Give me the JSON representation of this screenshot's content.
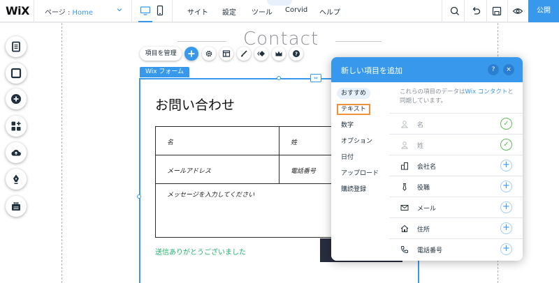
{
  "topbar": {
    "logo": "WiX",
    "page_label": "ページ : ",
    "page_value": "Home",
    "menu": [
      "サイト",
      "設定",
      "ツール",
      "Corvid",
      "ヘルプ"
    ],
    "publish_label": "公開"
  },
  "canvas": {
    "heading": "Contact"
  },
  "toolbar": {
    "manage_label": "項目を管理"
  },
  "form": {
    "tag_label": "Wix フォーム",
    "title": "お問い合わせ",
    "fields": {
      "first_name": "名",
      "last_name": "姓",
      "email": "メールアドレス",
      "phone": "電話番号",
      "message": "メッセージを入力してください"
    },
    "thanks": "送信ありがとうございました"
  },
  "panel": {
    "title": "新しい項目を追加",
    "help": "?",
    "close": "×",
    "categories": [
      "おすすめ",
      "テキスト",
      "数字",
      "オプション",
      "日付",
      "アップロード",
      "購読登録"
    ],
    "description_pre": "これらの項目のデータは",
    "description_link": "Wix コンタクト",
    "description_post": "と同期しています。",
    "items": [
      {
        "label": "名",
        "icon": "person-icon",
        "added": true
      },
      {
        "label": "姓",
        "icon": "person-icon",
        "added": true
      },
      {
        "label": "会社名",
        "icon": "building-icon",
        "added": false
      },
      {
        "label": "役職",
        "icon": "tie-icon",
        "added": false
      },
      {
        "label": "メール",
        "icon": "mail-icon",
        "added": false
      },
      {
        "label": "住所",
        "icon": "home-icon",
        "added": false
      },
      {
        "label": "電話番号",
        "icon": "phone-icon",
        "added": false
      }
    ]
  },
  "colors": {
    "accent": "#3899ec",
    "highlight": "#f0903b",
    "success": "#22b36b",
    "check": "#60bc57"
  }
}
